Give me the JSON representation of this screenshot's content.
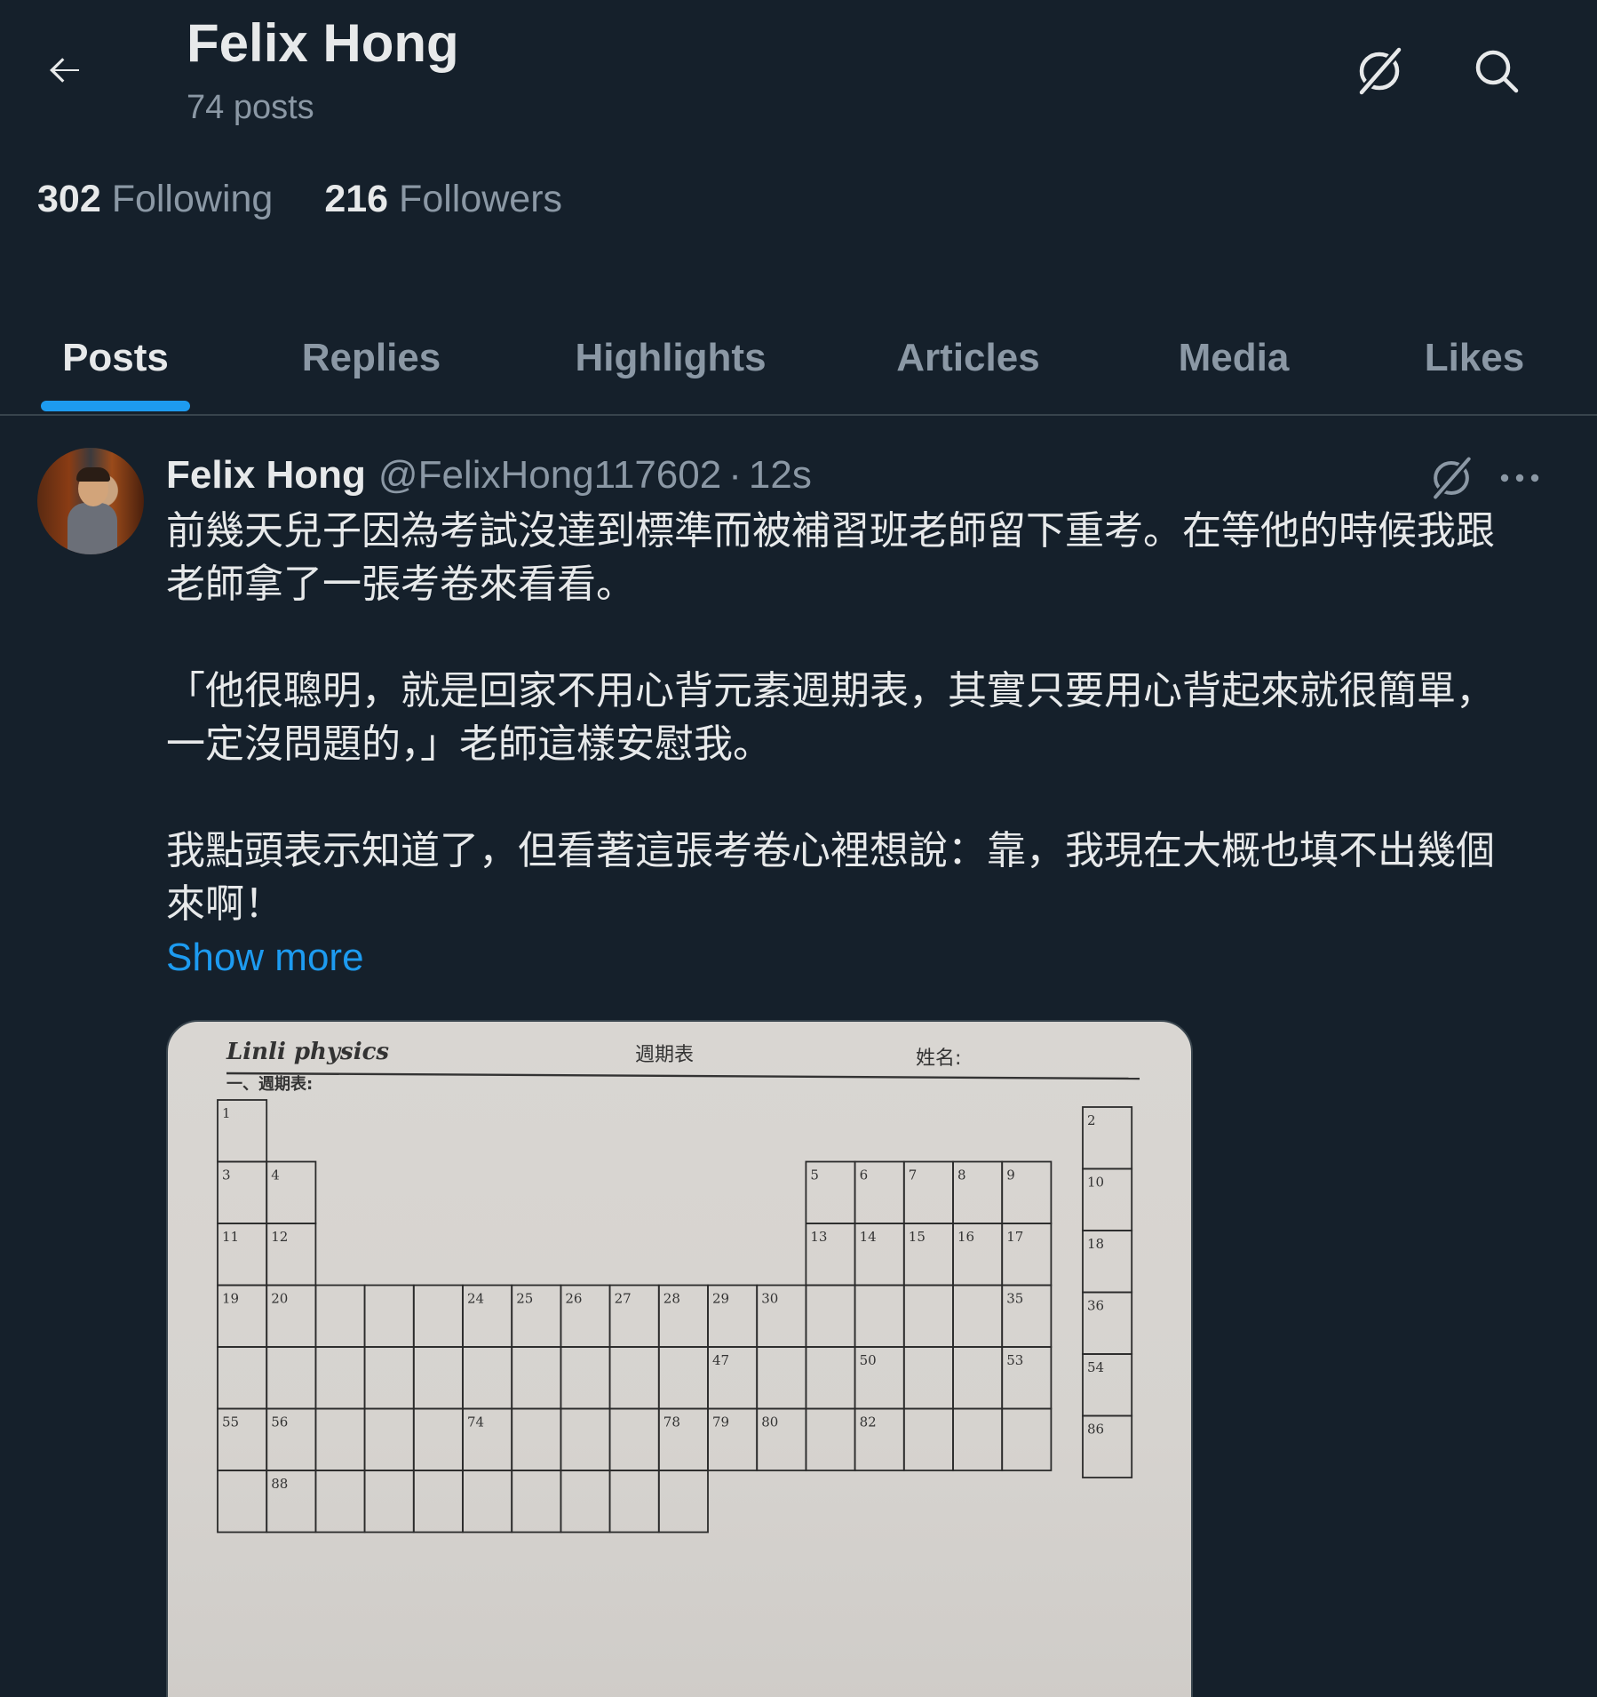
{
  "header": {
    "name": "Felix Hong",
    "post_count": "74 posts",
    "back_icon": "arrow-left-icon",
    "grok_icon": "grok-icon",
    "search_icon": "search-icon"
  },
  "stats": {
    "following_count": "302",
    "following_label": "Following",
    "followers_count": "216",
    "followers_label": "Followers"
  },
  "tabs": [
    {
      "label": "Posts",
      "active": true
    },
    {
      "label": "Replies",
      "active": false
    },
    {
      "label": "Highlights",
      "active": false
    },
    {
      "label": "Articles",
      "active": false
    },
    {
      "label": "Media",
      "active": false
    },
    {
      "label": "Likes",
      "active": false
    }
  ],
  "tweet": {
    "author_name": "Felix Hong",
    "handle": "@FelixHong117602",
    "separator": "·",
    "time": "12s",
    "lines": [
      "前幾天兒子因為考試沒達到標準而被補習班老師留下重考。在等他的時候我跟",
      "老師拿了一張考卷來看看。",
      "「他很聰明，就是回家不用心背元素週期表，其實只要用心背起來就很簡單，",
      "一定沒問題的，」老師這樣安慰我。",
      "我點頭表示知道了，但看著這張考卷心裡想說：靠，我現在大概也填不出幾個",
      "來啊！"
    ],
    "show_more": "Show more",
    "more_icon": "more-horizontal-icon",
    "grok_icon": "grok-icon"
  },
  "exam_sheet": {
    "brand": "Linli physics",
    "title": "週期表",
    "name_field": "姓名:",
    "section": "一、週期表:",
    "cell_numbers": [
      "1",
      "2",
      "3",
      "4",
      "5",
      "6",
      "7",
      "8",
      "9",
      "10",
      "11",
      "12",
      "13",
      "14",
      "15",
      "16",
      "17",
      "18",
      "19",
      "20",
      "24",
      "25",
      "26",
      "27",
      "28",
      "29",
      "30",
      "35",
      "36",
      "47",
      "50",
      "53",
      "54",
      "55",
      "56",
      "74",
      "78",
      "79",
      "80",
      "82",
      "86",
      "88"
    ]
  },
  "colors": {
    "background": "#15202b",
    "accent": "#1d9bf0",
    "text_primary": "#e7e9ea",
    "text_secondary": "#8b98a5",
    "divider": "#38444d"
  }
}
